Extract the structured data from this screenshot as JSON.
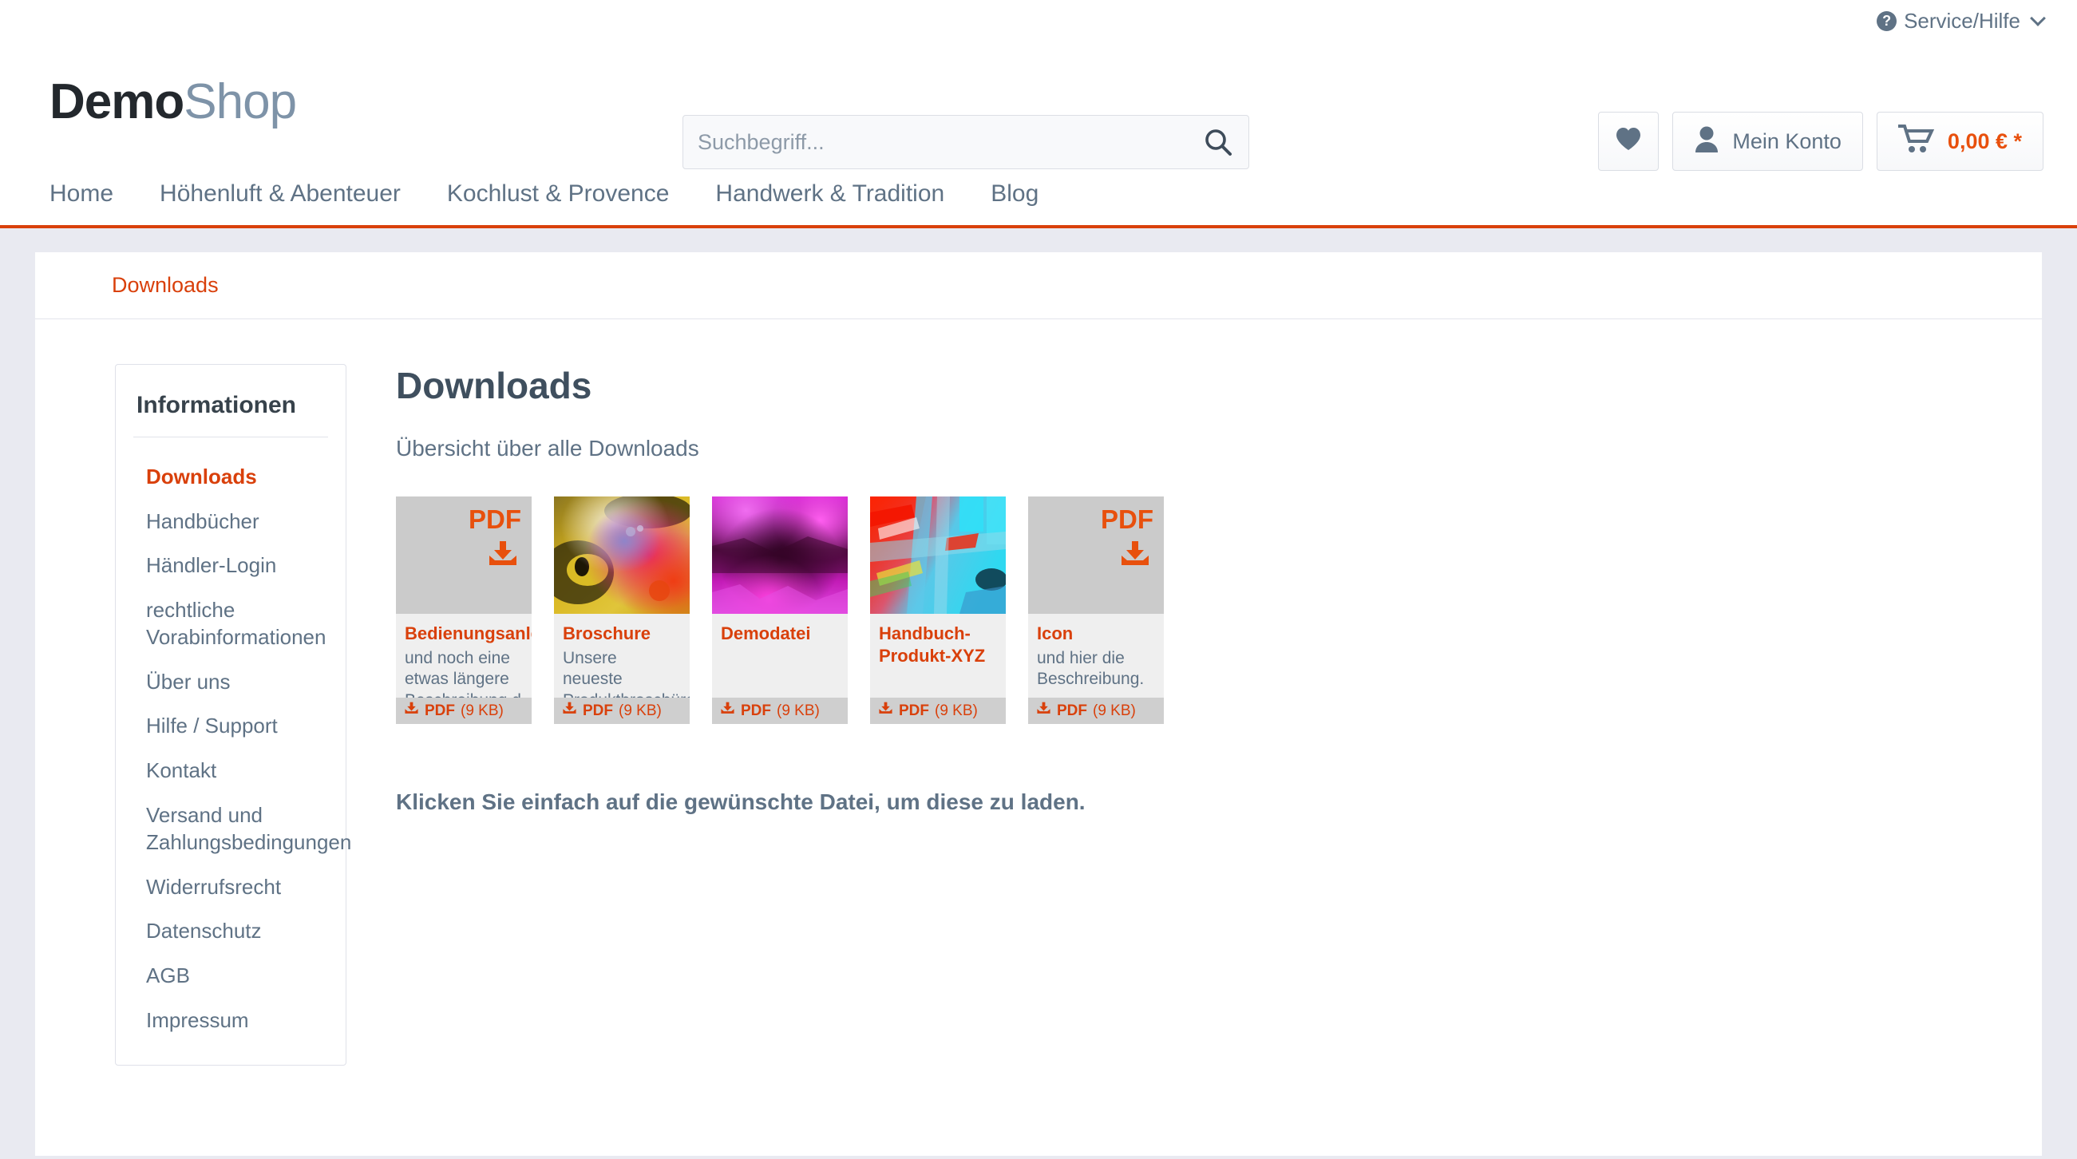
{
  "topbar": {
    "service_help": "Service/Hilfe",
    "help_icon": "question-circle-icon",
    "chevron_icon": "chevron-down-icon"
  },
  "header": {
    "logo_primary": "Demo",
    "logo_secondary": "Shop",
    "search": {
      "placeholder": "Suchbegriff...",
      "value": "",
      "icon": "search-icon"
    },
    "buttons": {
      "wishlist_icon": "heart-icon",
      "account_icon": "user-icon",
      "account_label": "Mein Konto",
      "cart_icon": "cart-icon",
      "cart_amount": "0,00 € *"
    }
  },
  "nav": {
    "items": [
      {
        "label": "Home"
      },
      {
        "label": "Höhenluft & Abenteuer"
      },
      {
        "label": "Kochlust & Provence"
      },
      {
        "label": "Handwerk & Tradition"
      },
      {
        "label": "Blog"
      }
    ]
  },
  "breadcrumb": {
    "items": [
      {
        "label": "Downloads"
      }
    ]
  },
  "sidebar": {
    "title": "Informationen",
    "items": [
      {
        "label": "Downloads",
        "active": true
      },
      {
        "label": "Handbücher",
        "active": false
      },
      {
        "label": "Händler-Login",
        "active": false
      },
      {
        "label": "rechtliche Vorabinformationen",
        "active": false
      },
      {
        "label": "Über uns",
        "active": false
      },
      {
        "label": "Hilfe / Support",
        "active": false
      },
      {
        "label": "Kontakt",
        "active": false
      },
      {
        "label": "Versand und Zahlungsbedingungen",
        "active": false
      },
      {
        "label": "Widerrufsrecht",
        "active": false
      },
      {
        "label": "Datenschutz",
        "active": false
      },
      {
        "label": "AGB",
        "active": false
      },
      {
        "label": "Impressum",
        "active": false
      }
    ]
  },
  "main": {
    "heading": "Downloads",
    "subheading": "Übersicht über alle Downloads",
    "hint": "Klicken Sie einfach auf die gewünschte Datei, um diese zu laden.",
    "cards": [
      {
        "title": "Bedienungsanleitung",
        "description": "und noch eine etwas längere Beschreibung d",
        "filetype": "PDF",
        "filesize": "(9 KB)",
        "thumb_type": "placeholder",
        "thumb_badge": "PDF",
        "download_icon": "download-inbox-icon"
      },
      {
        "title": "Broschure",
        "description": "Unsere neueste Produktbroschüre",
        "filetype": "PDF",
        "filesize": "(9 KB)",
        "thumb_type": "image",
        "thumb_badge": "",
        "download_icon": "download-inbox-icon"
      },
      {
        "title": "Demodatei",
        "description": "",
        "filetype": "PDF",
        "filesize": "(9 KB)",
        "thumb_type": "image",
        "thumb_badge": "",
        "download_icon": "download-inbox-icon"
      },
      {
        "title": "Handbuch-Produkt-XYZ",
        "description": "",
        "filetype": "PDF",
        "filesize": "(9 KB)",
        "thumb_type": "image",
        "thumb_badge": "",
        "download_icon": "download-inbox-icon"
      },
      {
        "title": "Icon",
        "description": "und hier die Beschreibung.",
        "filetype": "PDF",
        "filesize": "(9 KB)",
        "thumb_type": "placeholder",
        "thumb_badge": "PDF",
        "download_icon": "download-inbox-icon"
      }
    ]
  },
  "colors": {
    "accent": "#d9400b",
    "accent_bright": "#e8500d",
    "text": "#5f7285",
    "heading": "#3f4f5e",
    "page_bg": "#e9eaf1"
  }
}
